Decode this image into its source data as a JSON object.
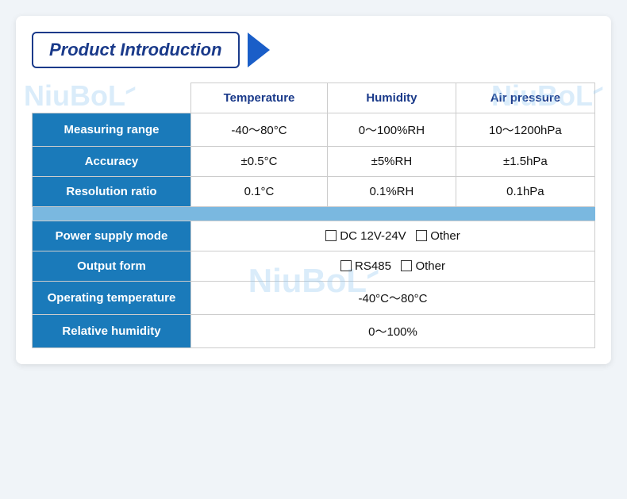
{
  "title": "Product Introduction",
  "watermark": "NiuBoL",
  "table": {
    "headers": [
      "",
      "Temperature",
      "Humidity",
      "Air pressure"
    ],
    "rows": [
      {
        "label": "Measuring range",
        "temperature": "-40～80°C",
        "humidity": "0～100%RH",
        "air_pressure": "10～1200hPa"
      },
      {
        "label": "Accuracy",
        "temperature": "±0.5°C",
        "humidity": "±5%RH",
        "air_pressure": "±1.5hPa"
      },
      {
        "label": "Resolution ratio",
        "temperature": "0.1°C",
        "humidity": "0.1%RH",
        "air_pressure": "0.1hPa"
      }
    ],
    "full_rows": [
      {
        "label": "Power supply mode",
        "value": "DC 12V-24V",
        "extra": "Other"
      },
      {
        "label": "Output form",
        "value": "RS485",
        "extra": "Other"
      },
      {
        "label": "Operating temperature",
        "value": "-40°C～80°C",
        "extra": ""
      },
      {
        "label": "Relative humidity",
        "value": "0～100%",
        "extra": ""
      }
    ]
  }
}
